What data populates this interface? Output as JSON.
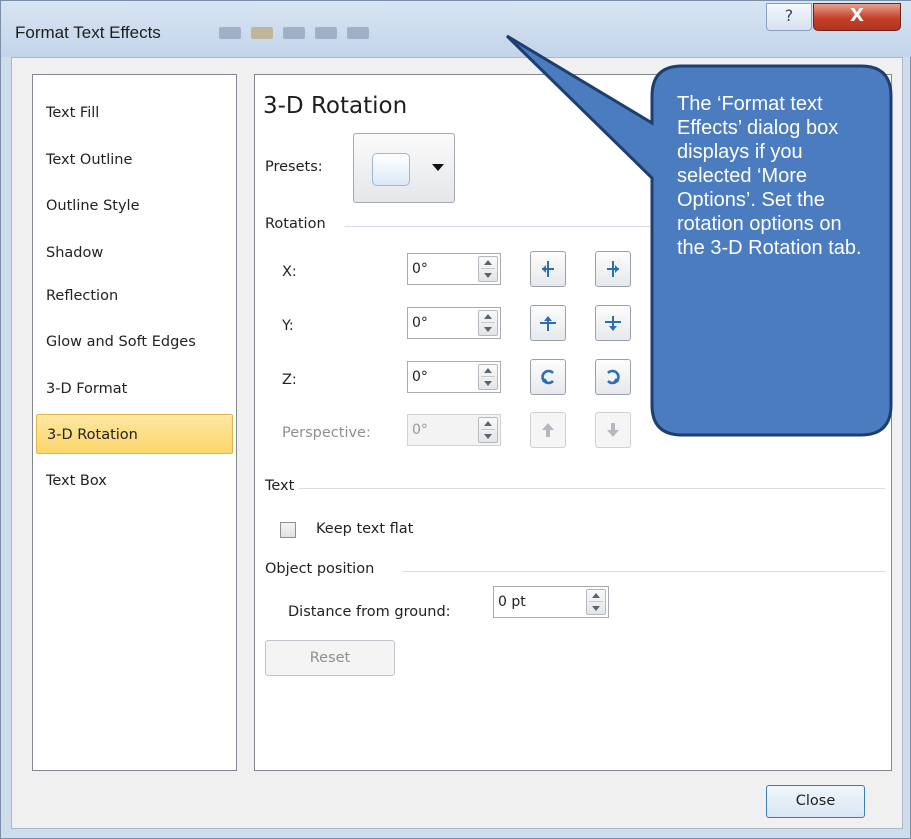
{
  "window": {
    "title": "Format Text Effects",
    "help_label": "?",
    "close_label": "X"
  },
  "nav": {
    "items": [
      {
        "label": "Text Fill"
      },
      {
        "label": "Text Outline"
      },
      {
        "label": "Outline Style"
      },
      {
        "label": "Shadow"
      },
      {
        "label": "Reflection"
      },
      {
        "label": "Glow and Soft Edges"
      },
      {
        "label": "3-D Format"
      },
      {
        "label": "3-D Rotation",
        "selected": true
      },
      {
        "label": "Text Box"
      }
    ]
  },
  "panel": {
    "title": "3-D Rotation",
    "presets_label": "Presets:",
    "rotation_group": "Rotation",
    "x_label": "X:",
    "x_value": "0°",
    "y_label": "Y:",
    "y_value": "0°",
    "z_label": "Z:",
    "z_value": "0°",
    "perspective_label": "Perspective:",
    "perspective_value": "0°",
    "text_group": "Text",
    "keep_flat_label": "Keep text flat",
    "keep_flat_checked": false,
    "object_group": "Object position",
    "distance_label": "Distance from ground:",
    "distance_value": "0 pt",
    "reset_label": "Reset"
  },
  "footer": {
    "close_label": "Close"
  },
  "callout": {
    "text": "The ‘Format text Effects’ dialog box displays if you selected ‘More Options’. Set the rotation options on the 3-D Rotation tab.",
    "fill": "#4a7cbf",
    "border": "#1d3e6e"
  }
}
